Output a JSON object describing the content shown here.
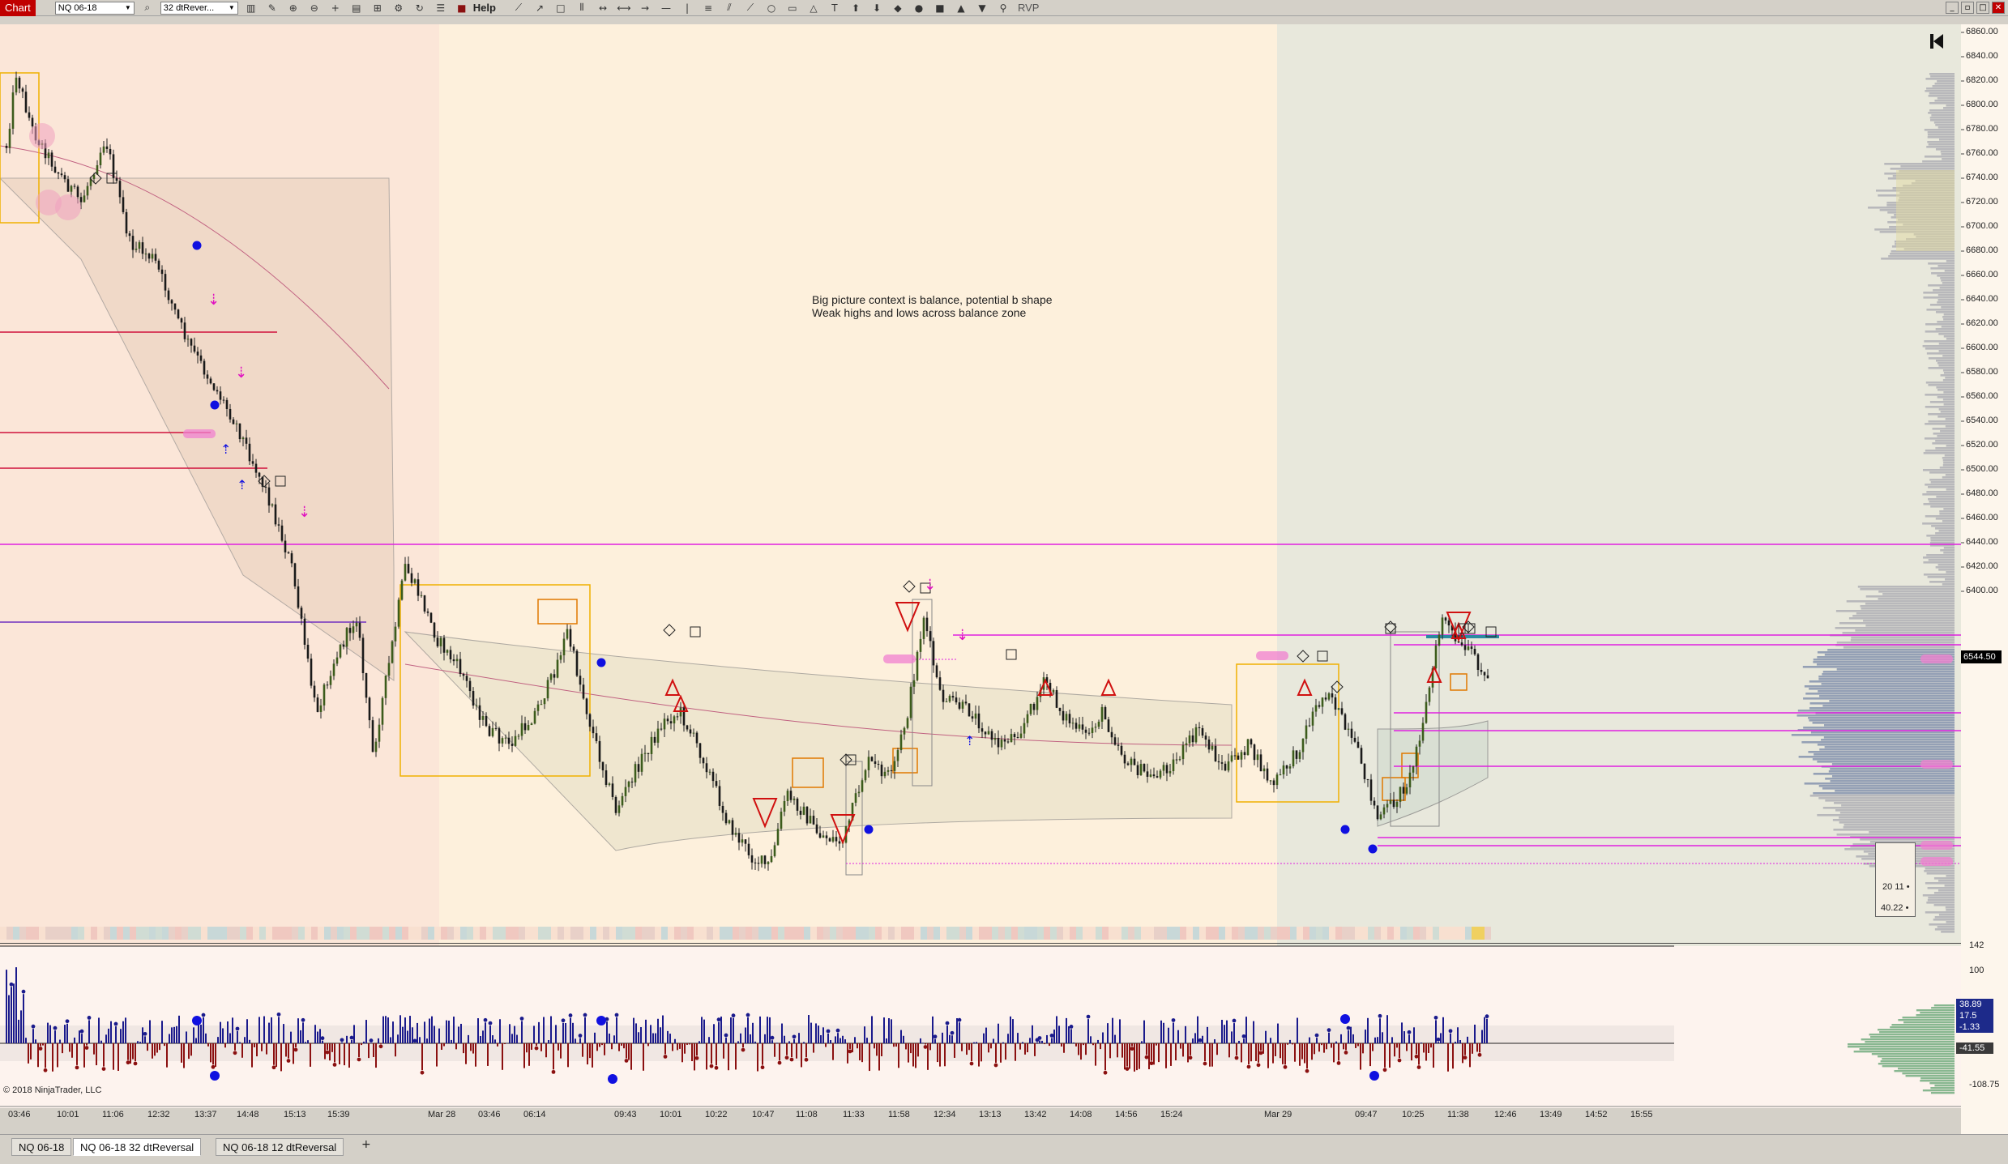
{
  "toolbar": {
    "chart_label": "Chart",
    "instrument": "NQ 06-18",
    "bar_type": "32 dtRever...",
    "help_label": "Help",
    "rvp_label": "RVP"
  },
  "icons": [
    "bars-icon",
    "pencil-icon",
    "zoom-in-icon",
    "zoom-out-icon",
    "crosshair-icon",
    "properties-icon",
    "data-box-icon",
    "strategy-icon",
    "reload-icon",
    "list-icon",
    "color-icon",
    "drawing-tools-icon"
  ],
  "annotation": {
    "line1": "Big picture context is balance, potential b shape",
    "line2": "Weak highs and lows across balance zone"
  },
  "price_axis": {
    "ticks": [
      "6860.00",
      "6840.00",
      "6820.00",
      "6800.00",
      "6780.00",
      "6760.00",
      "6740.00",
      "6720.00",
      "6700.00",
      "6680.00",
      "6660.00",
      "6640.00",
      "6620.00",
      "6600.00",
      "6580.00",
      "6560.00",
      "6540.00",
      "6520.00",
      "6500.00",
      "6480.00",
      "6460.00",
      "6440.00",
      "6420.00",
      "6400.00"
    ],
    "last_price": "6544.50"
  },
  "indicator_axis": {
    "ticks": [
      "142",
      "100",
      "-108.75"
    ],
    "flags": [
      {
        "value": "38.89",
        "color": "#1d2a8a"
      },
      {
        "value": "17.5",
        "color": "#1d2a8a"
      },
      {
        "value": "-1.33",
        "color": "#1d2a8a"
      },
      {
        "value": "-41.55",
        "color": "#3a3a3a"
      }
    ]
  },
  "mini_box": {
    "v1": "20 11 •",
    "v2": "40.22 •"
  },
  "time_axis": {
    "labels": [
      "03:46",
      "10:01",
      "11:06",
      "12:32",
      "13:37",
      "14:48",
      "15:13",
      "15:39",
      "Mar 28",
      "03:46",
      "06:14",
      "09:43",
      "10:01",
      "10:22",
      "10:47",
      "11:08",
      "11:33",
      "11:58",
      "12:34",
      "13:13",
      "13:42",
      "14:08",
      "14:56",
      "15:24",
      "Mar 29",
      "09:47",
      "10:25",
      "11:38",
      "12:46",
      "13:49",
      "14:52",
      "15:55"
    ]
  },
  "copyright": "© 2018 NinjaTrader, LLC",
  "tabs": [
    {
      "label": "NQ 06-18",
      "active": false
    },
    {
      "label": "NQ 06-18 32 dtReversal",
      "active": true
    },
    {
      "label": "NQ 06-18 12 dtReversal",
      "active": false
    }
  ],
  "colors": {
    "session1_bg": "#fbe6d8",
    "session2_bg": "#fdf0dc",
    "session3_bg": "#e8e8dc",
    "up_bar": "#1a1a8c",
    "down_bar": "#8b1010",
    "magenta_line": "#e020e0",
    "red_line": "#d0103a",
    "balance_box": "#f0b000"
  }
}
